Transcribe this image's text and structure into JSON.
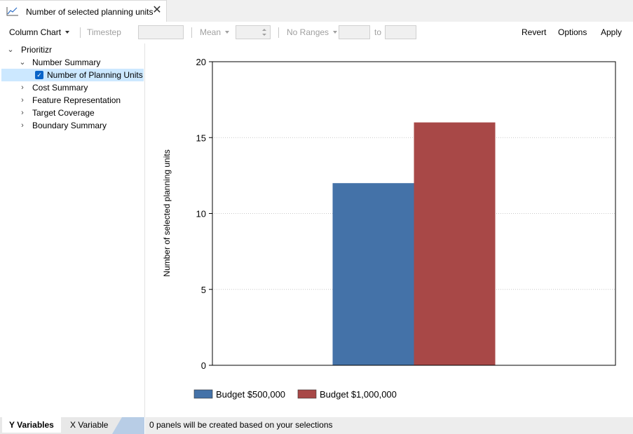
{
  "tab": {
    "title": "Number of selected planning units",
    "icon": "line-chart-icon",
    "close": "✕"
  },
  "toolbar": {
    "chart_type": "Column Chart",
    "timestep": "Timestep",
    "aggregate": "Mean",
    "ranges": "No Ranges",
    "to": "to",
    "revert": "Revert",
    "options": "Options",
    "apply": "Apply"
  },
  "tree": {
    "root": "Prioritizr",
    "groups": [
      {
        "label": "Number Summary",
        "expanded": true
      },
      {
        "label": "Cost Summary",
        "expanded": false
      },
      {
        "label": "Feature Representation",
        "expanded": false
      },
      {
        "label": "Target Coverage",
        "expanded": false
      },
      {
        "label": "Boundary Summary",
        "expanded": false
      }
    ],
    "selected_item": {
      "label": "Number of Planning Units",
      "checked": true
    }
  },
  "bottom_tabs": {
    "y": "Y Variables",
    "x": "X Variable"
  },
  "status": "0 panels will be created based on your selections",
  "colors": {
    "series1": "#4472a8",
    "series2": "#a84847",
    "selection": "#cce8ff"
  },
  "chart_data": {
    "type": "bar",
    "title": "",
    "xlabel": "",
    "ylabel": "Number of selected planning units",
    "ylim": [
      0,
      20
    ],
    "yticks": [
      0,
      5,
      10,
      15,
      20
    ],
    "grid": true,
    "legend_position": "bottom-left",
    "series": [
      {
        "name": "Budget $500,000",
        "values": [
          12
        ],
        "color": "#4472a8"
      },
      {
        "name": "Budget $1,000,000",
        "values": [
          16
        ],
        "color": "#a84847"
      }
    ]
  }
}
